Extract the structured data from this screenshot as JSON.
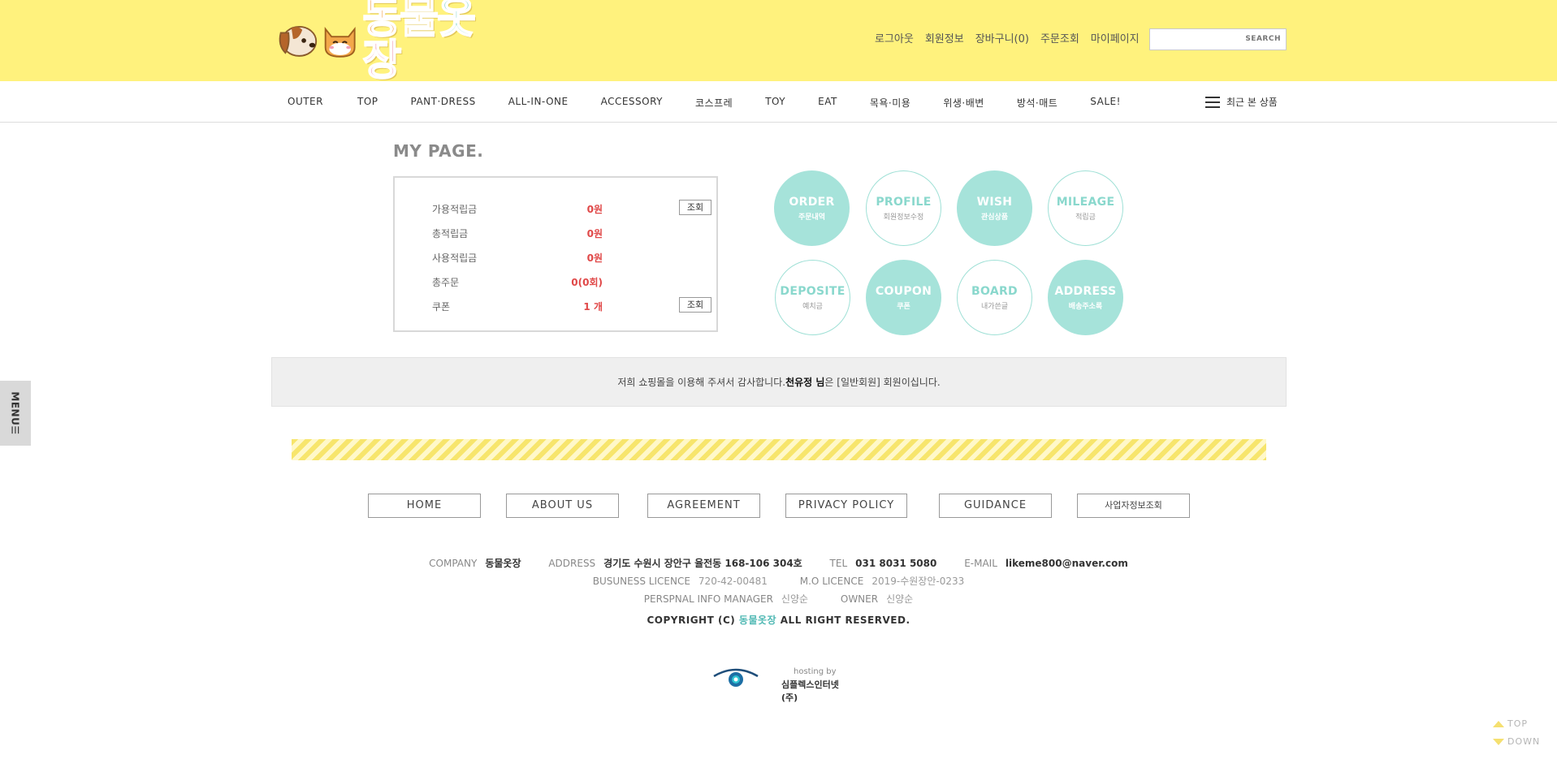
{
  "logo": {
    "chars": [
      "동",
      "물",
      "옷",
      "장"
    ],
    "colors": [
      "#f29c3a",
      "#f3c236",
      "#8ed6cf",
      "#f2a0b4"
    ]
  },
  "top_links": [
    "로그아웃",
    "회원정보",
    "장바구니(0)",
    "주문조회",
    "마이페이지"
  ],
  "search": {
    "placeholder": "",
    "label": "SEARCH"
  },
  "nav": {
    "items": [
      "OUTER",
      "TOP",
      "PANT·DRESS",
      "ALL-IN-ONE",
      "ACCESSORY",
      "코스프레",
      "TOY",
      "EAT",
      "목욕·미용",
      "위생·배변",
      "방석·매트",
      "SALE!"
    ],
    "recent_label": "최근 본 상품"
  },
  "side_menu_label": "MENU☰",
  "mypage": {
    "title": "MY PAGE.",
    "rows": [
      {
        "label": "가용적립금",
        "value": "0원",
        "button": "조회"
      },
      {
        "label": "총적립금",
        "value": "0원",
        "button": ""
      },
      {
        "label": "사용적립금",
        "value": "0원",
        "button": ""
      },
      {
        "label": "총주문",
        "value": "0(0회)",
        "button": ""
      },
      {
        "label": "쿠폰",
        "value": "1 개",
        "button": "조회"
      }
    ],
    "circles": [
      {
        "en": "ORDER",
        "ko": "주문내역",
        "style": "filled"
      },
      {
        "en": "PROFILE",
        "ko": "회원정보수정",
        "style": "outline"
      },
      {
        "en": "WISH",
        "ko": "관심상품",
        "style": "filled"
      },
      {
        "en": "MILEAGE",
        "ko": "적립금",
        "style": "outline"
      },
      {
        "en": "DEPOSITE",
        "ko": "예치금",
        "style": "outline"
      },
      {
        "en": "COUPON",
        "ko": "쿠폰",
        "style": "filled"
      },
      {
        "en": "BOARD",
        "ko": "내가쓴글",
        "style": "outline"
      },
      {
        "en": "ADDRESS",
        "ko": "배송주소록",
        "style": "filled"
      }
    ]
  },
  "greeting": {
    "before": "저희 쇼핑몰을 이용해 주셔서 감사합니다. ",
    "name": "천유정 님",
    "after": "은 [일반회원] 회원이십니다."
  },
  "footer_buttons": [
    "HOME",
    "ABOUT US",
    "AGREEMENT",
    "PRIVACY POLICY",
    "GUIDANCE",
    "사업자정보조회"
  ],
  "footer_info": {
    "company_label": "COMPANY",
    "company": "동물옷장",
    "address_label": "ADDRESS",
    "address": "경기도 수원시 장안구 율전동 168-106 304호",
    "tel_label": "TEL",
    "tel": "031 8031 5080",
    "email_label": "E-MAIL",
    "email": "likeme800@naver.com",
    "licence_label": "BUSUNESS LICENCE",
    "licence": "720-42-00481",
    "mo_label": "M.O LICENCE",
    "mo": "2019-수원장안-0233",
    "manager_label": "PERSPNAL INFO MANAGER",
    "manager": "신양순",
    "owner_label": "OWNER",
    "owner": "신양순"
  },
  "copyright": {
    "before": "COPYRIGHT (C) ",
    "brand": "동물옷장",
    "after": " ALL RIGHT RESERVED."
  },
  "hosting": {
    "by": "hosting by",
    "name": "심플렉스인터넷(주)"
  },
  "updown": {
    "top": "TOP",
    "down": "DOWN"
  }
}
